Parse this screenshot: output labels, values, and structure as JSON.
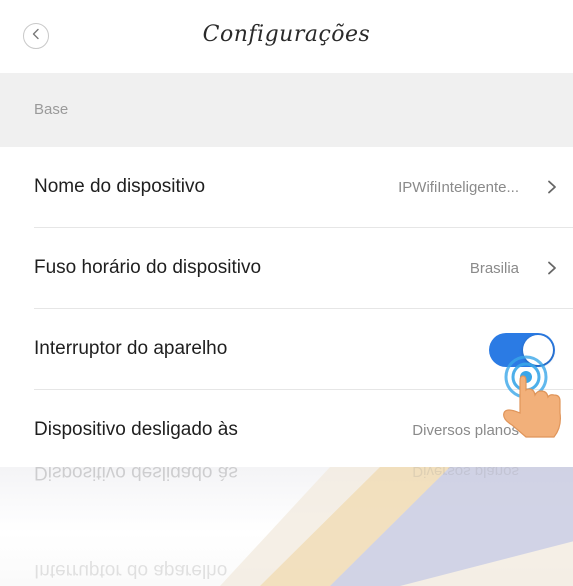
{
  "header": {
    "title": "Configurações",
    "back_icon": "chevron-left-icon"
  },
  "section": {
    "label": "Base"
  },
  "rows": [
    {
      "label": "Nome do dispositivo",
      "value": "IPWifiInteligente..."
    },
    {
      "label": "Fuso horário do dispositivo",
      "value": "Brasilia"
    },
    {
      "label": "Interruptor do aparelho",
      "toggle_on": true
    },
    {
      "label": "Dispositivo desligado às",
      "value": "Diversos planos"
    }
  ],
  "colors": {
    "accent": "#2b7be4",
    "section_bg": "#f0f0f0"
  }
}
